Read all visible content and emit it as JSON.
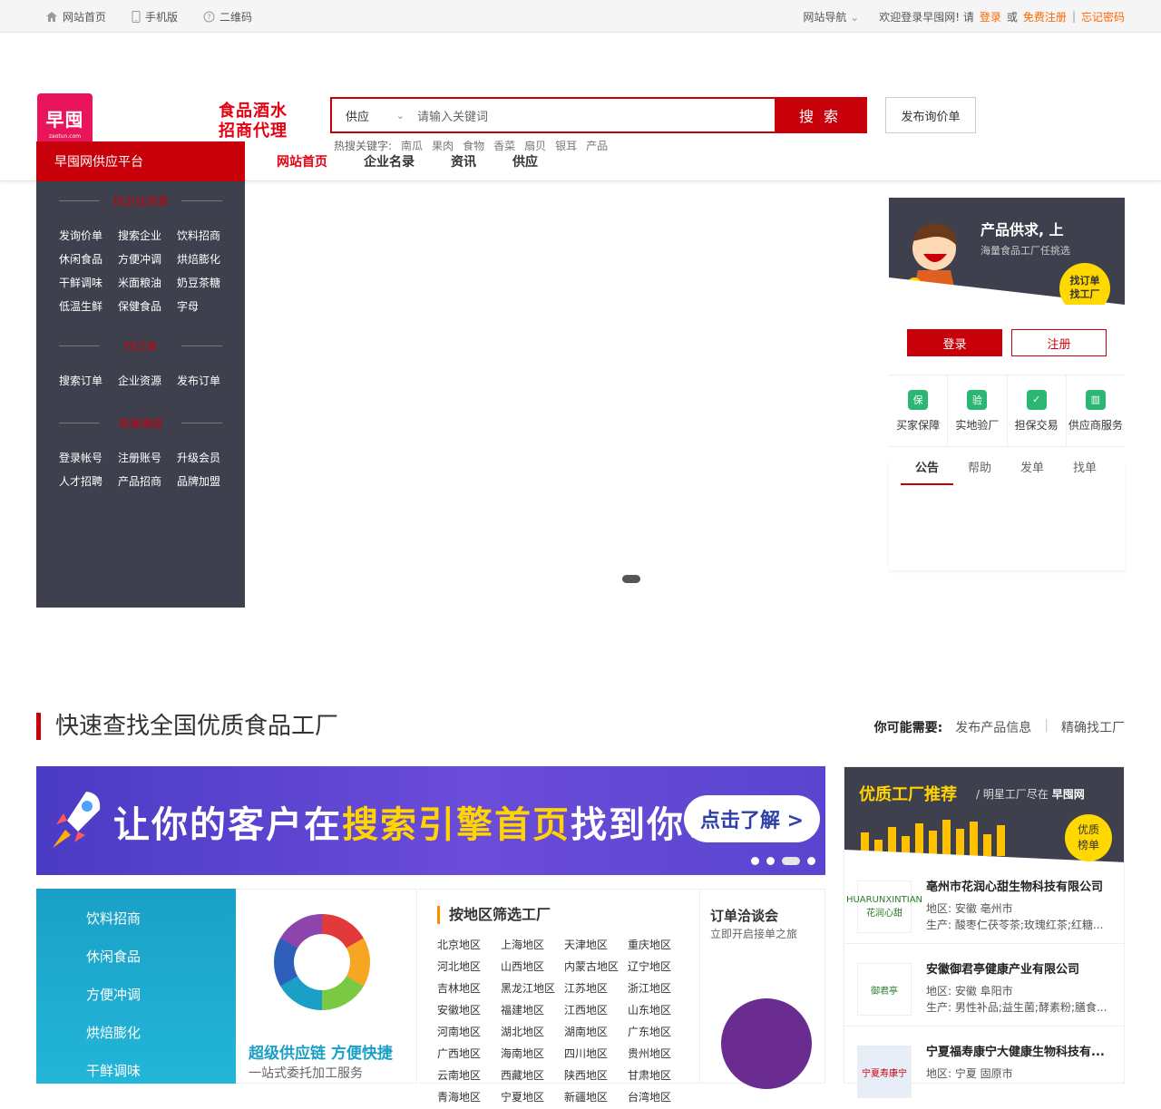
{
  "topbar": {
    "home": "网站首页",
    "mobile": "手机版",
    "qrcode": "二维码",
    "site_nav": "网站导航",
    "welcome": "欢迎登录早囤网! 请",
    "login": "登录",
    "or": "或",
    "register": "免费注册",
    "sep": "|",
    "forgot": "忘记密码"
  },
  "header": {
    "logo_text": "早囤",
    "logo_domain": "zaotun.com",
    "slogan_line1": "食品酒水",
    "slogan_line2": "招商代理",
    "search_type": "供应",
    "search_placeholder": "请输入关键词",
    "search_button": "搜 索",
    "hot_label": "热搜关键字:",
    "hot_keywords": [
      "南瓜",
      "果肉",
      "食物",
      "香菜",
      "扇贝",
      "银耳",
      "产品"
    ],
    "publish_button": "发布询价单"
  },
  "nav": {
    "category_title": "早囤网供应平台",
    "links": [
      "网站首页",
      "企业名录",
      "资讯",
      "供应"
    ]
  },
  "sidebar": {
    "section1_title": "找企业资源",
    "section1_items": [
      "发询价单",
      "搜索企业",
      "饮料招商",
      "休闲食品",
      "方便冲调",
      "烘焙膨化",
      "干鲜调味",
      "米面粮油",
      "奶豆茶糖",
      "低温生鲜",
      "保健食品",
      "字母"
    ],
    "section2_title": "找订单",
    "section2_items": [
      "搜索订单",
      "企业资源",
      "发布订单"
    ],
    "section3_title": "快速通道",
    "section3_items": [
      "登录帐号",
      "注册账号",
      "升级会员",
      "人才招聘",
      "产品招商",
      "品牌加盟"
    ]
  },
  "right_panel": {
    "promo_title": "产品供求, 上",
    "promo_sub": "海量食品工厂任挑选",
    "promo_badge_1": "找订单",
    "promo_badge_2": "找工厂",
    "login": "登录",
    "register": "注册",
    "services": [
      {
        "icon": "保",
        "label": "买家保障"
      },
      {
        "icon": "验",
        "label": "实地验厂"
      },
      {
        "icon": "✓",
        "label": "担保交易"
      },
      {
        "icon": "▥",
        "label": "供应商服务"
      }
    ],
    "tabs": [
      "公告",
      "帮助",
      "发单",
      "找单"
    ]
  },
  "section": {
    "title": "快速查找全国优质食品工厂",
    "need_label": "你可能需要:",
    "need_links": [
      "发布产品信息",
      "精确找工厂"
    ]
  },
  "banner": {
    "text_a": "让你的客户在",
    "text_b": "搜索引擎首页",
    "text_c": "找到你！",
    "cta": "点击了解 >"
  },
  "categories": [
    "饮料招商",
    "休闲食品",
    "方便冲调",
    "烘焙膨化",
    "干鲜调味"
  ],
  "supply": {
    "title": "超级供应链 方便快捷",
    "sub": "一站式委托加工服务"
  },
  "region": {
    "title": "按地区筛选工厂",
    "items": [
      "北京地区",
      "上海地区",
      "天津地区",
      "重庆地区",
      "河北地区",
      "山西地区",
      "内蒙古地区",
      "辽宁地区",
      "吉林地区",
      "黑龙江地区",
      "江苏地区",
      "浙江地区",
      "安徽地区",
      "福建地区",
      "江西地区",
      "山东地区",
      "河南地区",
      "湖北地区",
      "湖南地区",
      "广东地区",
      "广西地区",
      "海南地区",
      "四川地区",
      "贵州地区",
      "云南地区",
      "西藏地区",
      "陕西地区",
      "甘肃地区",
      "青海地区",
      "宁夏地区",
      "新疆地区",
      "台湾地区"
    ]
  },
  "expo": {
    "title": "订单洽谈会",
    "sub": "立即开启接单之旅"
  },
  "factories": {
    "title": "优质工厂推荐",
    "sub_a": "/ 明星工厂尽在",
    "sub_b": "早囤网",
    "badge_1": "优质",
    "badge_2": "榜单",
    "items": [
      {
        "logo": "HUARUNXINTIAN 花润心甜",
        "name": "亳州市花润心甜生物科技有限公司",
        "region": "地区: 安徽 亳州市",
        "products": "生产: 酸枣仁茯苓茶;玫瑰红茶;红糖..."
      },
      {
        "logo": "御君亭",
        "name": "安徽御君亭健康产业有限公司",
        "region": "地区: 安徽 阜阳市",
        "products": "生产: 男性补品;益生菌;酵素粉;膳食..."
      },
      {
        "logo": "宁夏寿康宁",
        "name": "宁夏福寿康宁大健康生物科技有...",
        "region": "地区: 宁夏 固原市",
        "products": ""
      }
    ]
  }
}
